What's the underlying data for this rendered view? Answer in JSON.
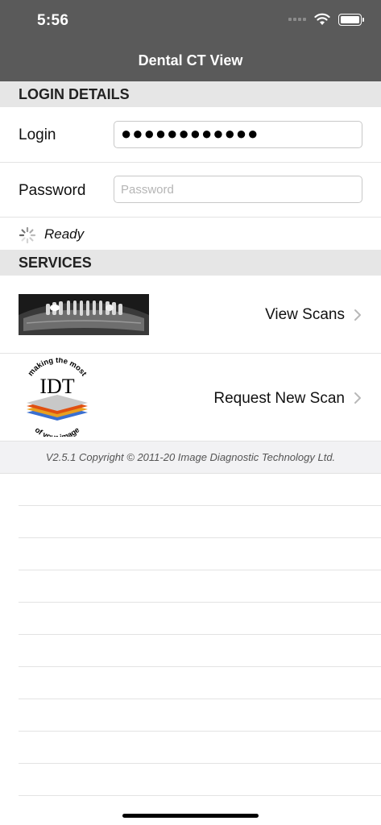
{
  "status_bar": {
    "time": "5:56"
  },
  "nav": {
    "title": "Dental CT View"
  },
  "login_section": {
    "header": "LOGIN DETAILS",
    "login_label": "Login",
    "login_value": "●●●●●●●●●●●●",
    "password_label": "Password",
    "password_placeholder": "Password",
    "status_text": "Ready"
  },
  "services_section": {
    "header": "SERVICES",
    "items": [
      {
        "label": "View Scans"
      },
      {
        "label": "Request New Scan"
      }
    ],
    "logo_text": "IDT",
    "logo_tagline_top": "making the most",
    "logo_tagline_bottom": "of your image"
  },
  "footer": {
    "copyright": "V2.5.1 Copyright © 2011-20 Image Diagnostic Technology Ltd."
  },
  "colors": {
    "nav_bg": "#5a5a5a",
    "section_bg": "#e6e6e6",
    "footer_bg": "#f2f2f4"
  }
}
